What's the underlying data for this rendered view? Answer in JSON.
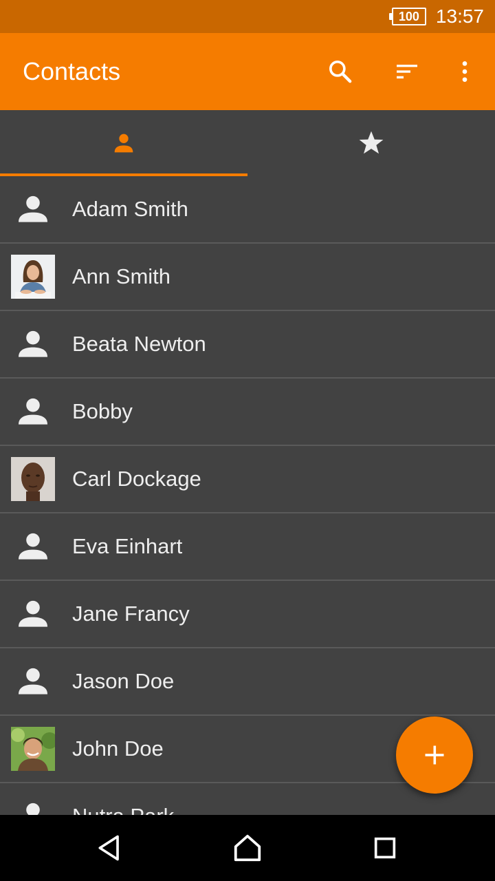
{
  "status_bar": {
    "battery": "100",
    "time": "13:57"
  },
  "app_bar": {
    "title": "Contacts",
    "actions": [
      "search-icon",
      "sort-icon",
      "more-vert-icon"
    ]
  },
  "tabs": [
    {
      "icon": "person-icon",
      "selected": true
    },
    {
      "icon": "star-icon",
      "selected": false
    }
  ],
  "contacts": [
    {
      "name": "Adam Smith",
      "avatar": "placeholder"
    },
    {
      "name": "Ann Smith",
      "avatar": "photo"
    },
    {
      "name": "Beata Newton",
      "avatar": "placeholder"
    },
    {
      "name": "Bobby",
      "avatar": "placeholder"
    },
    {
      "name": "Carl Dockage",
      "avatar": "photo"
    },
    {
      "name": "Eva Einhart",
      "avatar": "placeholder"
    },
    {
      "name": "Jane Francy",
      "avatar": "placeholder"
    },
    {
      "name": "Jason Doe",
      "avatar": "placeholder"
    },
    {
      "name": "John Doe",
      "avatar": "photo"
    },
    {
      "name": "Nutra Park",
      "avatar": "placeholder"
    }
  ],
  "fab": {
    "icon": "add-icon"
  },
  "colors": {
    "accent": "#f57c00",
    "status_bar": "#c96700",
    "background": "#424242",
    "divider": "#5a5a5a"
  }
}
